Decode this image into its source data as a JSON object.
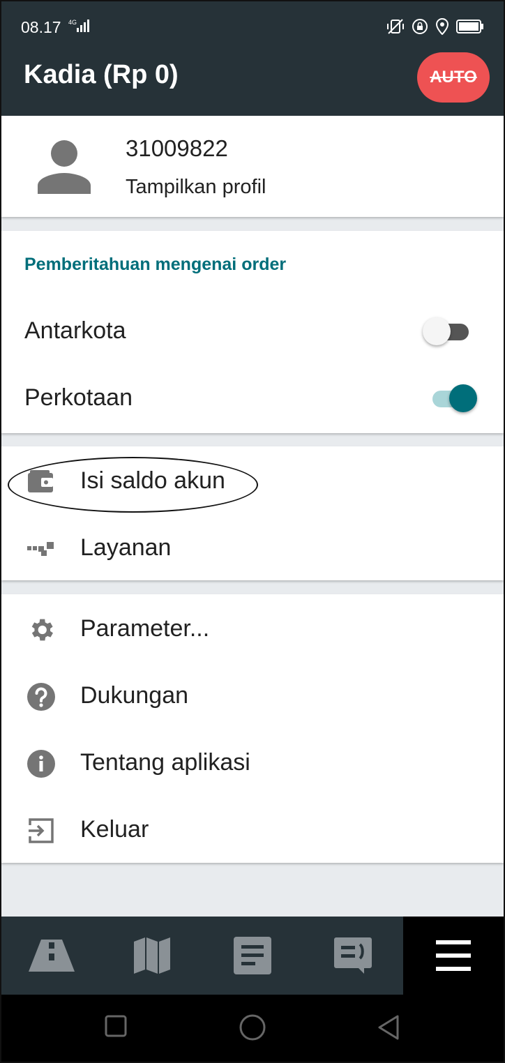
{
  "status_bar": {
    "time": "08.17",
    "network": "4G"
  },
  "app_bar": {
    "title": "Kadia (Rp 0)",
    "auto_button": "AUTO"
  },
  "profile": {
    "id": "31009822",
    "link": "Tampilkan profil"
  },
  "notifications": {
    "title": "Pemberitahuan mengenai order",
    "items": [
      {
        "label": "Antarkota",
        "enabled": false
      },
      {
        "label": "Perkotaan",
        "enabled": true
      }
    ]
  },
  "wallet_menu": [
    {
      "label": "Isi saldo akun",
      "icon": "wallet-icon"
    },
    {
      "label": "Layanan",
      "icon": "taxi-checker-icon"
    }
  ],
  "misc_menu": [
    {
      "label": "Parameter...",
      "icon": "gear-icon"
    },
    {
      "label": "Dukungan",
      "icon": "help-icon"
    },
    {
      "label": "Tentang aplikasi",
      "icon": "info-icon"
    },
    {
      "label": "Keluar",
      "icon": "exit-icon"
    }
  ],
  "bottom_nav": [
    {
      "icon": "road-icon",
      "active": false
    },
    {
      "icon": "map-icon",
      "active": false
    },
    {
      "icon": "orders-list-icon",
      "active": false
    },
    {
      "icon": "chat-icon",
      "active": false
    },
    {
      "icon": "hamburger-menu-icon",
      "active": true
    }
  ],
  "colors": {
    "app_bar": "#263238",
    "accent": "#006e7a",
    "auto_button": "#ee5253"
  }
}
